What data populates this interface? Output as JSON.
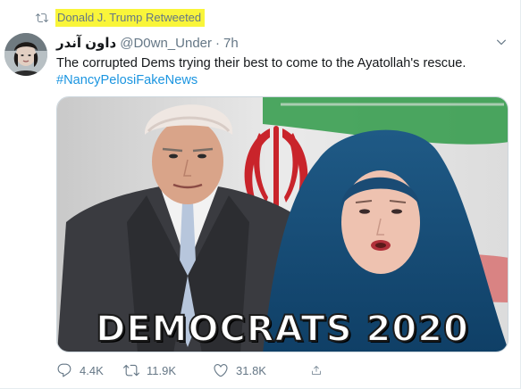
{
  "retweet_context": {
    "icon": "retweet-icon",
    "label": "Donald J. Trump Retweeted",
    "highlight_color": "#f9f53a"
  },
  "author": {
    "display_name": "داون آندر",
    "handle": "@D0wn_Under",
    "separator": "·",
    "time": "7h"
  },
  "tweet": {
    "text": "The corrupted Dems trying their best to come to the Ayatollah's rescue.",
    "hashtag": "#NancyPelosiFakeNews"
  },
  "media": {
    "caption": "DEMOCRATS 2020"
  },
  "actions": {
    "replies": "4.4K",
    "retweets": "11.9K",
    "likes": "31.8K"
  },
  "colors": {
    "text_primary": "#14171a",
    "text_secondary": "#657786",
    "link": "#1b95e0",
    "border": "#e6ecf0"
  }
}
